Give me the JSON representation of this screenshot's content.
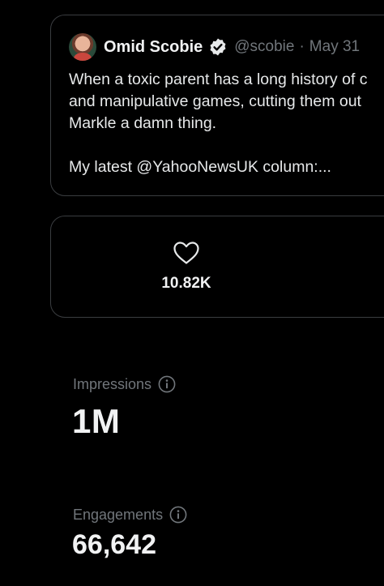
{
  "quoted_tweet": {
    "author_name": "Omid Scobie",
    "handle": "@scobie",
    "separator": "·",
    "date": "May 31",
    "lines": [
      "When a toxic parent has a long history of c",
      "and manipulative games, cutting them out",
      "Markle a damn thing.",
      "My latest @YahooNewsUK column:..."
    ]
  },
  "likes": {
    "count": "10.82K",
    "icon": "heart-icon"
  },
  "metrics": {
    "impressions_label": "Impressions",
    "impressions_value": "1M",
    "engagements_label": "Engagements",
    "engagements_value": "66,642",
    "info_icon": "info-icon"
  },
  "colors": {
    "background": "#000000",
    "border": "#3a3d40",
    "primary_text": "#e7e9ea",
    "secondary_text": "#71767b",
    "verified_badge": "#e7e9ea"
  }
}
